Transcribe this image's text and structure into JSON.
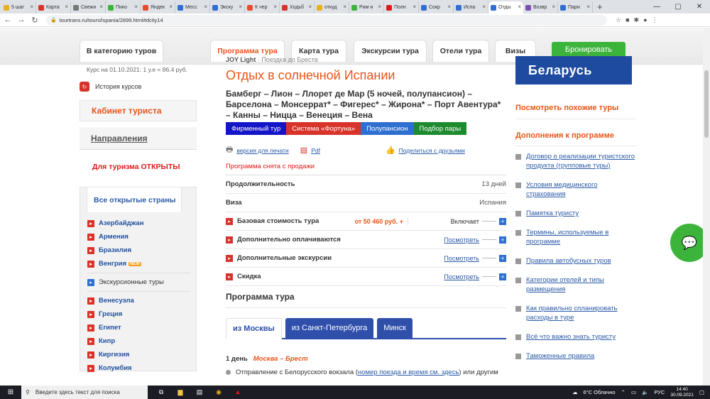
{
  "browser": {
    "tabs": [
      {
        "label": "5 шаг",
        "color": "#e8b020"
      },
      {
        "label": "Карта",
        "color": "#d8332a"
      },
      {
        "label": "Свежи",
        "color": "#777"
      },
      {
        "label": "Пико",
        "color": "#3cb43c"
      },
      {
        "label": "Яндек",
        "color": "#e84a2a"
      },
      {
        "label": "Месс",
        "color": "#2f6fd0"
      },
      {
        "label": "Экску",
        "color": "#2f6fd0"
      },
      {
        "label": "К чер",
        "color": "#e84a2a"
      },
      {
        "label": "Ходьб",
        "color": "#d8332a"
      },
      {
        "label": "откуд",
        "color": "#e8b020"
      },
      {
        "label": "Рим и",
        "color": "#3cb43c"
      },
      {
        "label": "Полн",
        "color": "#e01818"
      },
      {
        "label": "Сокр",
        "color": "#2f6fd0"
      },
      {
        "label": "Испа",
        "color": "#2f6fd0"
      },
      {
        "label": "Отды",
        "color": "#2f6fd0"
      },
      {
        "label": "Возвр",
        "color": "#7a4fb0"
      },
      {
        "label": "Пари",
        "color": "#2f6fd0"
      }
    ],
    "new_tab": "+",
    "url": "tourtrans.ru/tours/ispania/2899.html#dcity14"
  },
  "nav": {
    "category": "В категорию туров",
    "tabs": [
      "Программа тура",
      "Карта тура",
      "Экскурсии тура",
      "Отели тура",
      "Визы"
    ],
    "book": "Бронировать"
  },
  "left": {
    "rate": "Курс на 01.10.2021: 1 у.е = 86.4 руб.",
    "history": "История курсов",
    "cabinet": "Кабинет туриста",
    "directions": "Направления",
    "open_prefix": "Для туризма ",
    "open_word": "ОТКРЫТЫ",
    "countries_title": "Все открытые страны",
    "countries": [
      "Азербайджан",
      "Армения",
      "Бразилия",
      "Венгрия"
    ],
    "new_badge": "NEW",
    "excursion": "Экскурсионные туры",
    "countries2": [
      "Венесуэла",
      "Греция",
      "Египет",
      "Кипр",
      "Киргизия",
      "Колумбия"
    ]
  },
  "main": {
    "subtitle_bold": "JOY Light",
    "subtitle_rest": " · Поездка до Бреста",
    "title": "Отдых в солнечной Испании",
    "route": "Бамберг – Лион – Ллорет де Мар (5 ночей, полупансион) – Барселона – Монсеррат* – Фигерес* – Жирона* – Порт Авентура* – Канны – Ницца – Венеция – Вена",
    "badges": [
      {
        "label": "Фирменный тур",
        "color": "#1414c8"
      },
      {
        "label": "Система «Фортуна»",
        "color": "#d8332a"
      },
      {
        "label": "Полупансион",
        "color": "#2f6fd0"
      },
      {
        "label": "Подбор пары",
        "color": "#1e8a2e"
      }
    ],
    "print": "версия для печати",
    "pdf": "Pdf",
    "share": "Поделиться с друзьями",
    "removed": "Программа снята с продажи",
    "duration_label": "Продолжительность",
    "duration_value": "13 дней",
    "visa_label": "Виза",
    "visa_value": "Испания",
    "base_label": "Базовая стоимость тура",
    "base_price": "от 50 460 руб. +",
    "base_action": "Включает",
    "extra_label": "Дополнительно оплачиваются",
    "extra_action": "Посмотреть",
    "exc_label": "Дополнительные экскурсии",
    "exc_action": "Посмотреть",
    "disc_label": "Скидка",
    "disc_action": "Посмотреть",
    "program_title": "Программа тура",
    "city_tabs": [
      "из Москвы",
      "из Санкт-Петербурга",
      "Минск"
    ],
    "day1": "1 день",
    "day1_route": "Москва – Брест",
    "day1_text_a": "Отправление с Белорусского вокзала (",
    "day1_link": "номер поезда и время см. здесь",
    "day1_text_b": ") или другим"
  },
  "right": {
    "banner": "Беларусь",
    "similar": "Посмотреть похожие туры",
    "additions": "Дополнения к программе",
    "links": [
      "Договор о реализации туристского продукта (групповые туры)",
      "Условия медицинского страхования",
      "Памятка туристу",
      "Термины, используемые в программе",
      "Правила автобусных туров",
      "Категории отелей и типы размещения",
      "Как правильно спланировать расходы в туре",
      "Всё что важно знать туристу",
      "Таможенные правила"
    ]
  },
  "taskbar": {
    "search": "Введите здесь текст для поиска",
    "weather": "6°C Облачно",
    "lang": "РУС",
    "time": "14:40",
    "date": "30.09.2021"
  }
}
